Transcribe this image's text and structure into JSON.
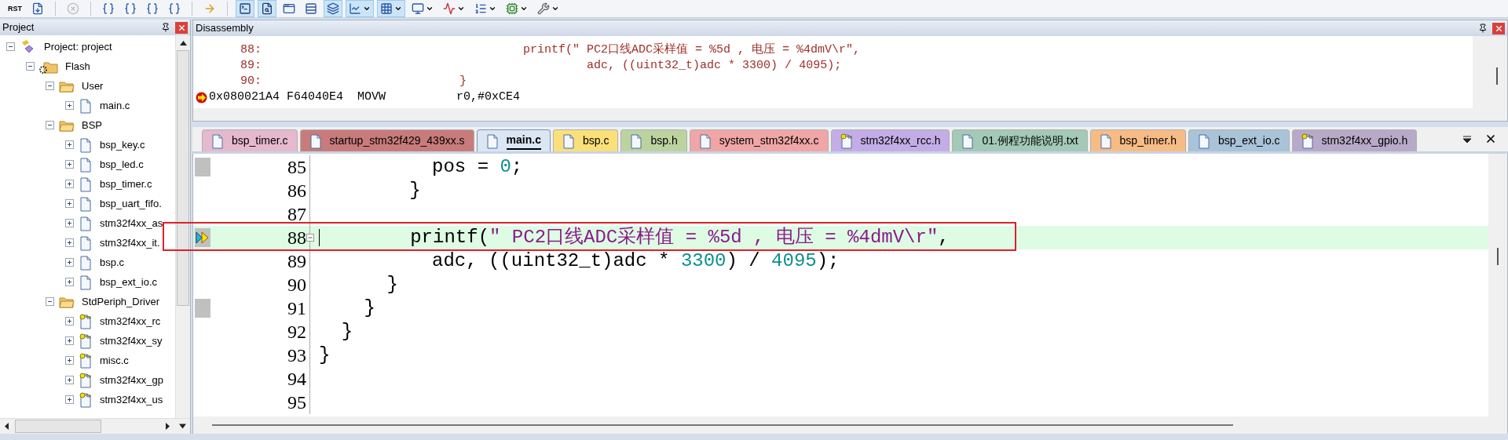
{
  "toolbar": [
    {
      "kind": "rst",
      "label": "RST",
      "pressed": false,
      "disabled": false
    },
    {
      "kind": "reset-list",
      "pressed": false,
      "disabled": false
    },
    {
      "kind": "stop",
      "pressed": false,
      "disabled": true
    },
    {
      "kind": "step-in",
      "pressed": false,
      "disabled": false
    },
    {
      "kind": "step-over",
      "pressed": false,
      "disabled": false
    },
    {
      "kind": "step-out",
      "pressed": false,
      "disabled": false
    },
    {
      "kind": "run-to-cursor",
      "pressed": false,
      "disabled": false
    },
    {
      "kind": "next-statement",
      "pressed": false,
      "disabled": false
    },
    {
      "kind": "command",
      "pressed": true,
      "disabled": false
    },
    {
      "kind": "disassembly",
      "pressed": true,
      "disabled": false
    },
    {
      "kind": "symbols",
      "pressed": false,
      "disabled": false
    },
    {
      "kind": "registers",
      "pressed": false,
      "disabled": false
    },
    {
      "kind": "call-stack",
      "pressed": true,
      "disabled": false
    },
    {
      "kind": "watch",
      "pressed": true,
      "disabled": false
    },
    {
      "kind": "memory",
      "pressed": true,
      "disabled": false
    },
    {
      "kind": "serial",
      "pressed": false,
      "disabled": false
    },
    {
      "kind": "analysis",
      "pressed": false,
      "disabled": false
    },
    {
      "kind": "trace",
      "pressed": false,
      "disabled": false
    },
    {
      "kind": "system",
      "pressed": false,
      "disabled": false
    },
    {
      "kind": "toolbox",
      "pressed": false,
      "disabled": false
    }
  ],
  "project_panel": {
    "title": "Project",
    "tree": [
      {
        "label": "Project: project",
        "kind": "project",
        "expanded": true,
        "children": [
          {
            "label": "Flash",
            "kind": "target",
            "expanded": true,
            "children": [
              {
                "label": "User",
                "kind": "folder",
                "expanded": true,
                "children": [
                  {
                    "label": "main.c",
                    "kind": "file",
                    "expanded": false
                  }
                ]
              },
              {
                "label": "BSP",
                "kind": "folder",
                "expanded": true,
                "children": [
                  {
                    "label": "bsp_key.c",
                    "kind": "file",
                    "expanded": false
                  },
                  {
                    "label": "bsp_led.c",
                    "kind": "file",
                    "expanded": false
                  },
                  {
                    "label": "bsp_timer.c",
                    "kind": "file",
                    "expanded": false
                  },
                  {
                    "label": "bsp_uart_fifo.",
                    "kind": "file",
                    "expanded": false
                  },
                  {
                    "label": "stm32f4xx_as",
                    "kind": "file",
                    "expanded": false
                  },
                  {
                    "label": "stm32f4xx_it.",
                    "kind": "file",
                    "expanded": false
                  },
                  {
                    "label": "bsp.c",
                    "kind": "file",
                    "expanded": false
                  },
                  {
                    "label": "bsp_ext_io.c",
                    "kind": "file",
                    "expanded": false
                  }
                ]
              },
              {
                "label": "StdPeriph_Driver",
                "kind": "folder",
                "expanded": true,
                "children": [
                  {
                    "label": "stm32f4xx_rc",
                    "kind": "locked-file",
                    "expanded": false
                  },
                  {
                    "label": "stm32f4xx_sy",
                    "kind": "locked-file",
                    "expanded": false
                  },
                  {
                    "label": "misc.c",
                    "kind": "locked-file",
                    "expanded": false
                  },
                  {
                    "label": "stm32f4xx_gp",
                    "kind": "locked-file",
                    "expanded": false
                  },
                  {
                    "label": "stm32f4xx_us",
                    "kind": "locked-file",
                    "expanded": false
                  }
                ]
              }
            ]
          }
        ]
      }
    ]
  },
  "disassembly": {
    "title": "Disassembly",
    "lines": [
      {
        "kind": "source",
        "number": "88:",
        "text": "                                     printf(\" PC2口线ADC采样值 = %5d , 电压 = %4dmV\\r\","
      },
      {
        "kind": "source",
        "number": "89:",
        "text": "                                              adc, ((uint32_t)adc * 3300) / 4095);"
      },
      {
        "kind": "source",
        "number": "90:",
        "text": "                            }"
      },
      {
        "kind": "instruction",
        "current": true,
        "text": "0x080021A4 F64040E4  MOVW          r0,#0xCE4"
      }
    ]
  },
  "tabs": [
    {
      "label": "bsp_timer.c",
      "kind": "file",
      "color": "#e6b9cf",
      "selected": false
    },
    {
      "label": "startup_stm32f429_439xx.s",
      "kind": "file",
      "color": "#c97b7b",
      "selected": false
    },
    {
      "label": "main.c",
      "kind": "file",
      "color": "#dbe6f5",
      "selected": true
    },
    {
      "label": "bsp.c",
      "kind": "file",
      "color": "#fbe07a",
      "selected": false
    },
    {
      "label": "bsp.h",
      "kind": "file",
      "color": "#bcd3a0",
      "selected": false
    },
    {
      "label": "system_stm32f4xx.c",
      "kind": "file",
      "color": "#f0a6a6",
      "selected": false
    },
    {
      "label": "stm32f4xx_rcc.h",
      "kind": "locked-file",
      "color": "#c4ade6",
      "selected": false
    },
    {
      "label": "01.例程功能说明.txt",
      "kind": "file",
      "color": "#a3c9b7",
      "selected": false
    },
    {
      "label": "bsp_timer.h",
      "kind": "file",
      "color": "#f7bb85",
      "selected": false
    },
    {
      "label": "bsp_ext_io.c",
      "kind": "file",
      "color": "#a9c3d8",
      "selected": false
    },
    {
      "label": "stm32f4xx_gpio.h",
      "kind": "locked-file",
      "color": "#b9a9c8",
      "selected": false
    }
  ],
  "editor": {
    "lines": [
      {
        "number": "85",
        "marked": true,
        "current": false,
        "foldable": false,
        "tokens": [
          {
            "kind": "plain",
            "text": "          pos = "
          },
          {
            "kind": "number",
            "text": "0"
          },
          {
            "kind": "plain",
            "text": ";"
          }
        ]
      },
      {
        "number": "86",
        "marked": false,
        "current": false,
        "foldable": false,
        "tokens": [
          {
            "kind": "plain",
            "text": "        }"
          }
        ]
      },
      {
        "number": "87",
        "marked": false,
        "current": false,
        "foldable": false
      },
      {
        "number": "88",
        "marked": true,
        "current": true,
        "foldable": true,
        "tokens": [
          {
            "kind": "plain",
            "text": "        printf("
          },
          {
            "kind": "string",
            "text": "″ PC2口线ADC采样值 = %5d , 电压 = %4dmV\\r″"
          },
          {
            "kind": "plain",
            "text": ","
          }
        ]
      },
      {
        "number": "89",
        "marked": false,
        "current": false,
        "foldable": false,
        "tokens": [
          {
            "kind": "plain",
            "text": "          adc, ((uint32_t)adc * "
          },
          {
            "kind": "number",
            "text": "3300"
          },
          {
            "kind": "plain",
            "text": ") / "
          },
          {
            "kind": "number",
            "text": "4095"
          },
          {
            "kind": "plain",
            "text": ");"
          }
        ]
      },
      {
        "number": "90",
        "marked": false,
        "current": false,
        "foldable": false,
        "tokens": [
          {
            "kind": "plain",
            "text": "      }"
          }
        ]
      },
      {
        "number": "91",
        "marked": true,
        "current": false,
        "foldable": false,
        "tokens": [
          {
            "kind": "plain",
            "text": "    }"
          }
        ]
      },
      {
        "number": "92",
        "marked": false,
        "current": false,
        "foldable": false,
        "tokens": [
          {
            "kind": "plain",
            "text": "  }"
          }
        ]
      },
      {
        "number": "93",
        "marked": false,
        "current": false,
        "foldable": false,
        "tokens": [
          {
            "kind": "plain",
            "text": "}"
          }
        ]
      },
      {
        "number": "94",
        "marked": false,
        "current": false,
        "foldable": false
      },
      {
        "number": "95",
        "marked": false,
        "current": false,
        "foldable": false
      }
    ]
  },
  "annotation": {
    "kind": "frame",
    "color": "#e0202a"
  }
}
